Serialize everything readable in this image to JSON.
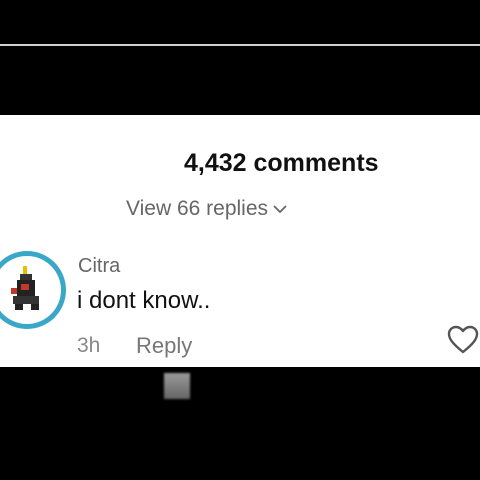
{
  "comments_header": {
    "count_label": "4,432 comments"
  },
  "replies": {
    "view_label": "View 66 replies",
    "expand_icon": "chevron-down-icon"
  },
  "comment": {
    "username": "Citra",
    "text": "i dont know..",
    "time": "3h",
    "reply_label": "Reply",
    "like_icon": "heart-outline-icon",
    "avatar_ring_color": "#3aa7c9"
  },
  "colors": {
    "background": "#000000",
    "panel": "#ffffff",
    "primary_text": "#111111",
    "secondary_text": "#666666"
  }
}
